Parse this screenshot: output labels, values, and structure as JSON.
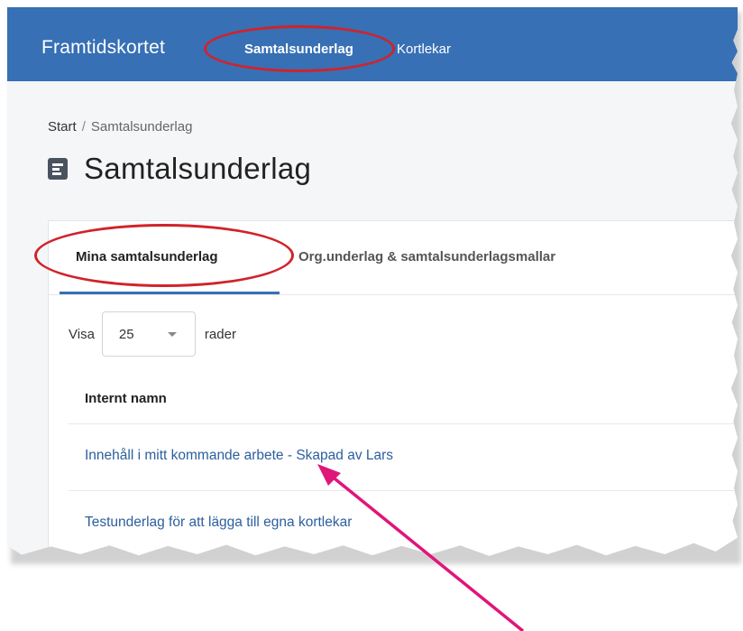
{
  "navbar": {
    "brand": "Framtidskortet",
    "links": [
      "Samtalsunderlag",
      "Kortlekar"
    ]
  },
  "breadcrumb": {
    "home": "Start",
    "separator": "/",
    "current": "Samtalsunderlag"
  },
  "page": {
    "title": "Samtalsunderlag",
    "icon": "document-icon"
  },
  "tabs": [
    {
      "label": "Mina samtalsunderlag",
      "active": true
    },
    {
      "label": "Org.underlag & samtalsunderlagsmallar",
      "active": false
    }
  ],
  "table_controls": {
    "show_label": "Visa",
    "page_size": "25",
    "rows_label": "rader"
  },
  "table": {
    "columns": [
      "Internt namn"
    ],
    "rows": [
      "Innehåll i mitt kommande arbete - Skapad av Lars",
      "Testunderlag för att lägga till egna kortlekar"
    ]
  },
  "annotations": {
    "highlight_color": "#d0232b",
    "arrow_color": "#e0157a"
  },
  "colors": {
    "navbar": "#3770b5",
    "link": "#2c5f9e"
  }
}
